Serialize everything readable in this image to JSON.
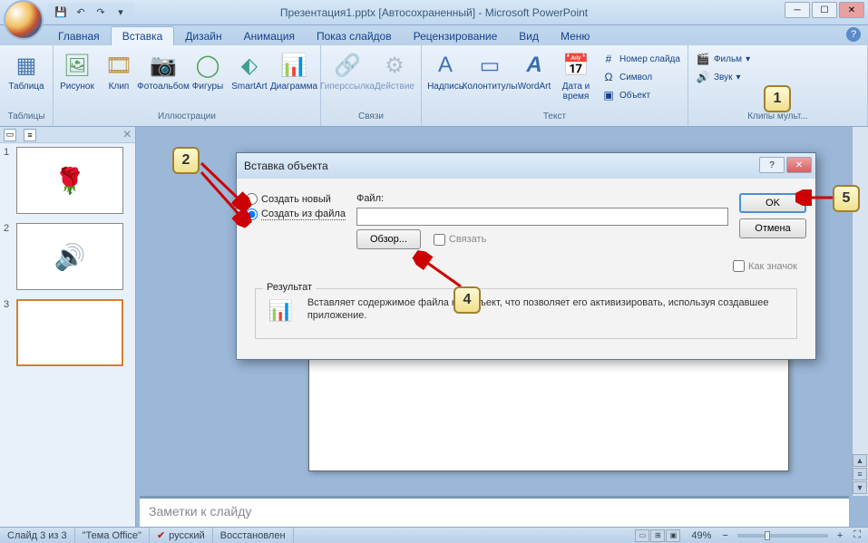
{
  "title": "Презентация1.pptx [Автосохраненный] - Microsoft PowerPoint",
  "qat": {
    "save": "💾",
    "undo": "↶",
    "redo": "↷",
    "more": "▾"
  },
  "tabs": [
    "Главная",
    "Вставка",
    "Дизайн",
    "Анимация",
    "Показ слайдов",
    "Рецензирование",
    "Вид",
    "Меню"
  ],
  "active_tab": "Вставка",
  "ribbon": {
    "groups": [
      {
        "label": "Таблицы",
        "items": [
          {
            "label": "Таблица",
            "icon": "▦"
          }
        ]
      },
      {
        "label": "Иллюстрации",
        "items": [
          {
            "label": "Рисунок",
            "icon": "🖼"
          },
          {
            "label": "Клип",
            "icon": "🎞"
          },
          {
            "label": "Фотоальбом",
            "icon": "📷"
          },
          {
            "label": "Фигуры",
            "icon": "◯"
          },
          {
            "label": "SmartArt",
            "icon": "⬖"
          },
          {
            "label": "Диаграмма",
            "icon": "📊"
          }
        ]
      },
      {
        "label": "Связи",
        "items": [
          {
            "label": "Гиперссылка",
            "icon": "🔗",
            "disabled": true
          },
          {
            "label": "Действие",
            "icon": "⚙",
            "disabled": true
          }
        ]
      },
      {
        "label": "Текст",
        "items": [
          {
            "label": "Надпись",
            "icon": "A"
          },
          {
            "label": "Колонтитулы",
            "icon": "▭"
          },
          {
            "label": "WordArt",
            "icon": "A"
          },
          {
            "label": "Дата и время",
            "icon": "📅"
          }
        ],
        "small": [
          {
            "label": "Номер слайда",
            "icon": "#"
          },
          {
            "label": "Символ",
            "icon": "Ω"
          },
          {
            "label": "Объект",
            "icon": "▣"
          }
        ]
      },
      {
        "label": "Клипы мульт...",
        "small": [
          {
            "label": "Фильм",
            "icon": "🎬"
          },
          {
            "label": "Звук",
            "icon": "🔊"
          }
        ]
      }
    ]
  },
  "slides": {
    "panel_close": "×",
    "items": [
      {
        "num": "1",
        "thumb_glyph": "🌹"
      },
      {
        "num": "2",
        "thumb_glyph": "🔊"
      },
      {
        "num": "3",
        "thumb_glyph": ""
      }
    ],
    "active_index": 2
  },
  "notes_placeholder": "Заметки к слайду",
  "status": {
    "slide_of": "Слайд 3 из 3",
    "theme": "\"Тема Office\"",
    "lang": "русский",
    "recovered": "Восстановлен",
    "zoom": "49%"
  },
  "dialog": {
    "title": "Вставка объекта",
    "radio_new": "Создать новый",
    "radio_file": "Создать из файла",
    "selected_radio": "file",
    "file_label": "Файл:",
    "browse": "Обзор...",
    "link_chk": "Связать",
    "asicon_chk": "Как значок",
    "ok": "OK",
    "cancel": "Отмена",
    "result_label": "Результат",
    "result_text": "Вставляет содержимое файла как объект, что позволяет его активизировать, используя создавшее приложение."
  },
  "callouts": {
    "c1": "1",
    "c2": "2",
    "c4": "4",
    "c5": "5"
  }
}
